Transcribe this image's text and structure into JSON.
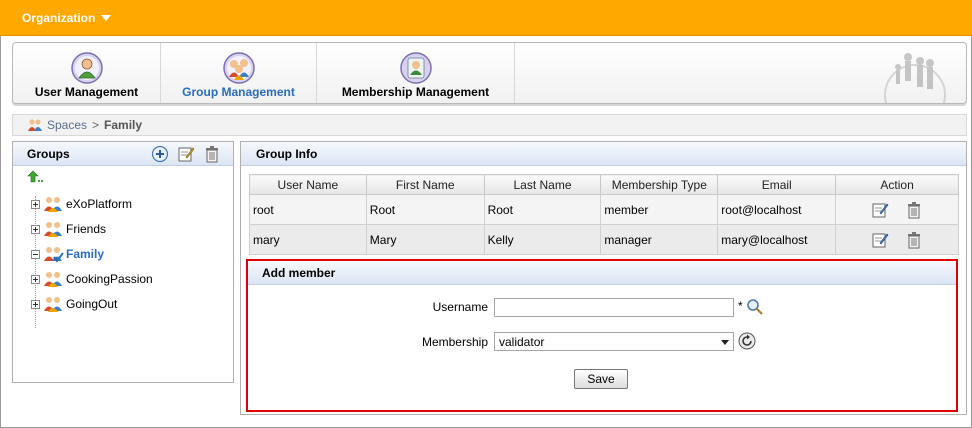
{
  "topbar": {
    "menu_label": "Organization",
    "color": "#ffa800"
  },
  "tabs": [
    {
      "label": "User Management",
      "icon": "user-icon",
      "active": false
    },
    {
      "label": "Group Management",
      "icon": "group-icon",
      "active": true
    },
    {
      "label": "Membership Management",
      "icon": "membership-icon",
      "active": false
    }
  ],
  "breadcrumb": {
    "root": "Spaces",
    "separator": ">",
    "current": "Family"
  },
  "groups": {
    "title": "Groups",
    "actions": [
      "add-icon",
      "edit-icon",
      "delete-icon"
    ],
    "items": [
      {
        "label": "eXoPlatform",
        "expanded": false,
        "selected": false
      },
      {
        "label": "Friends",
        "expanded": false,
        "selected": false
      },
      {
        "label": "Family",
        "expanded": true,
        "selected": true
      },
      {
        "label": "CookingPassion",
        "expanded": false,
        "selected": false
      },
      {
        "label": "GoingOut",
        "expanded": false,
        "selected": false
      }
    ]
  },
  "group_info": {
    "title": "Group Info",
    "columns": [
      "User Name",
      "First Name",
      "Last Name",
      "Membership Type",
      "Email",
      "Action"
    ],
    "rows": [
      {
        "username": "root",
        "first": "Root",
        "last": "Root",
        "type": "member",
        "email": "root@localhost"
      },
      {
        "username": "mary",
        "first": "Mary",
        "last": "Kelly",
        "type": "manager",
        "email": "mary@localhost"
      }
    ]
  },
  "add_member": {
    "title": "Add member",
    "username_label": "Username",
    "username_value": "",
    "required_mark": "*",
    "membership_label": "Membership",
    "membership_value": "validator",
    "save_label": "Save"
  },
  "colors": {
    "accent": "#2a6cbf",
    "highlight_border": "#e00000"
  }
}
